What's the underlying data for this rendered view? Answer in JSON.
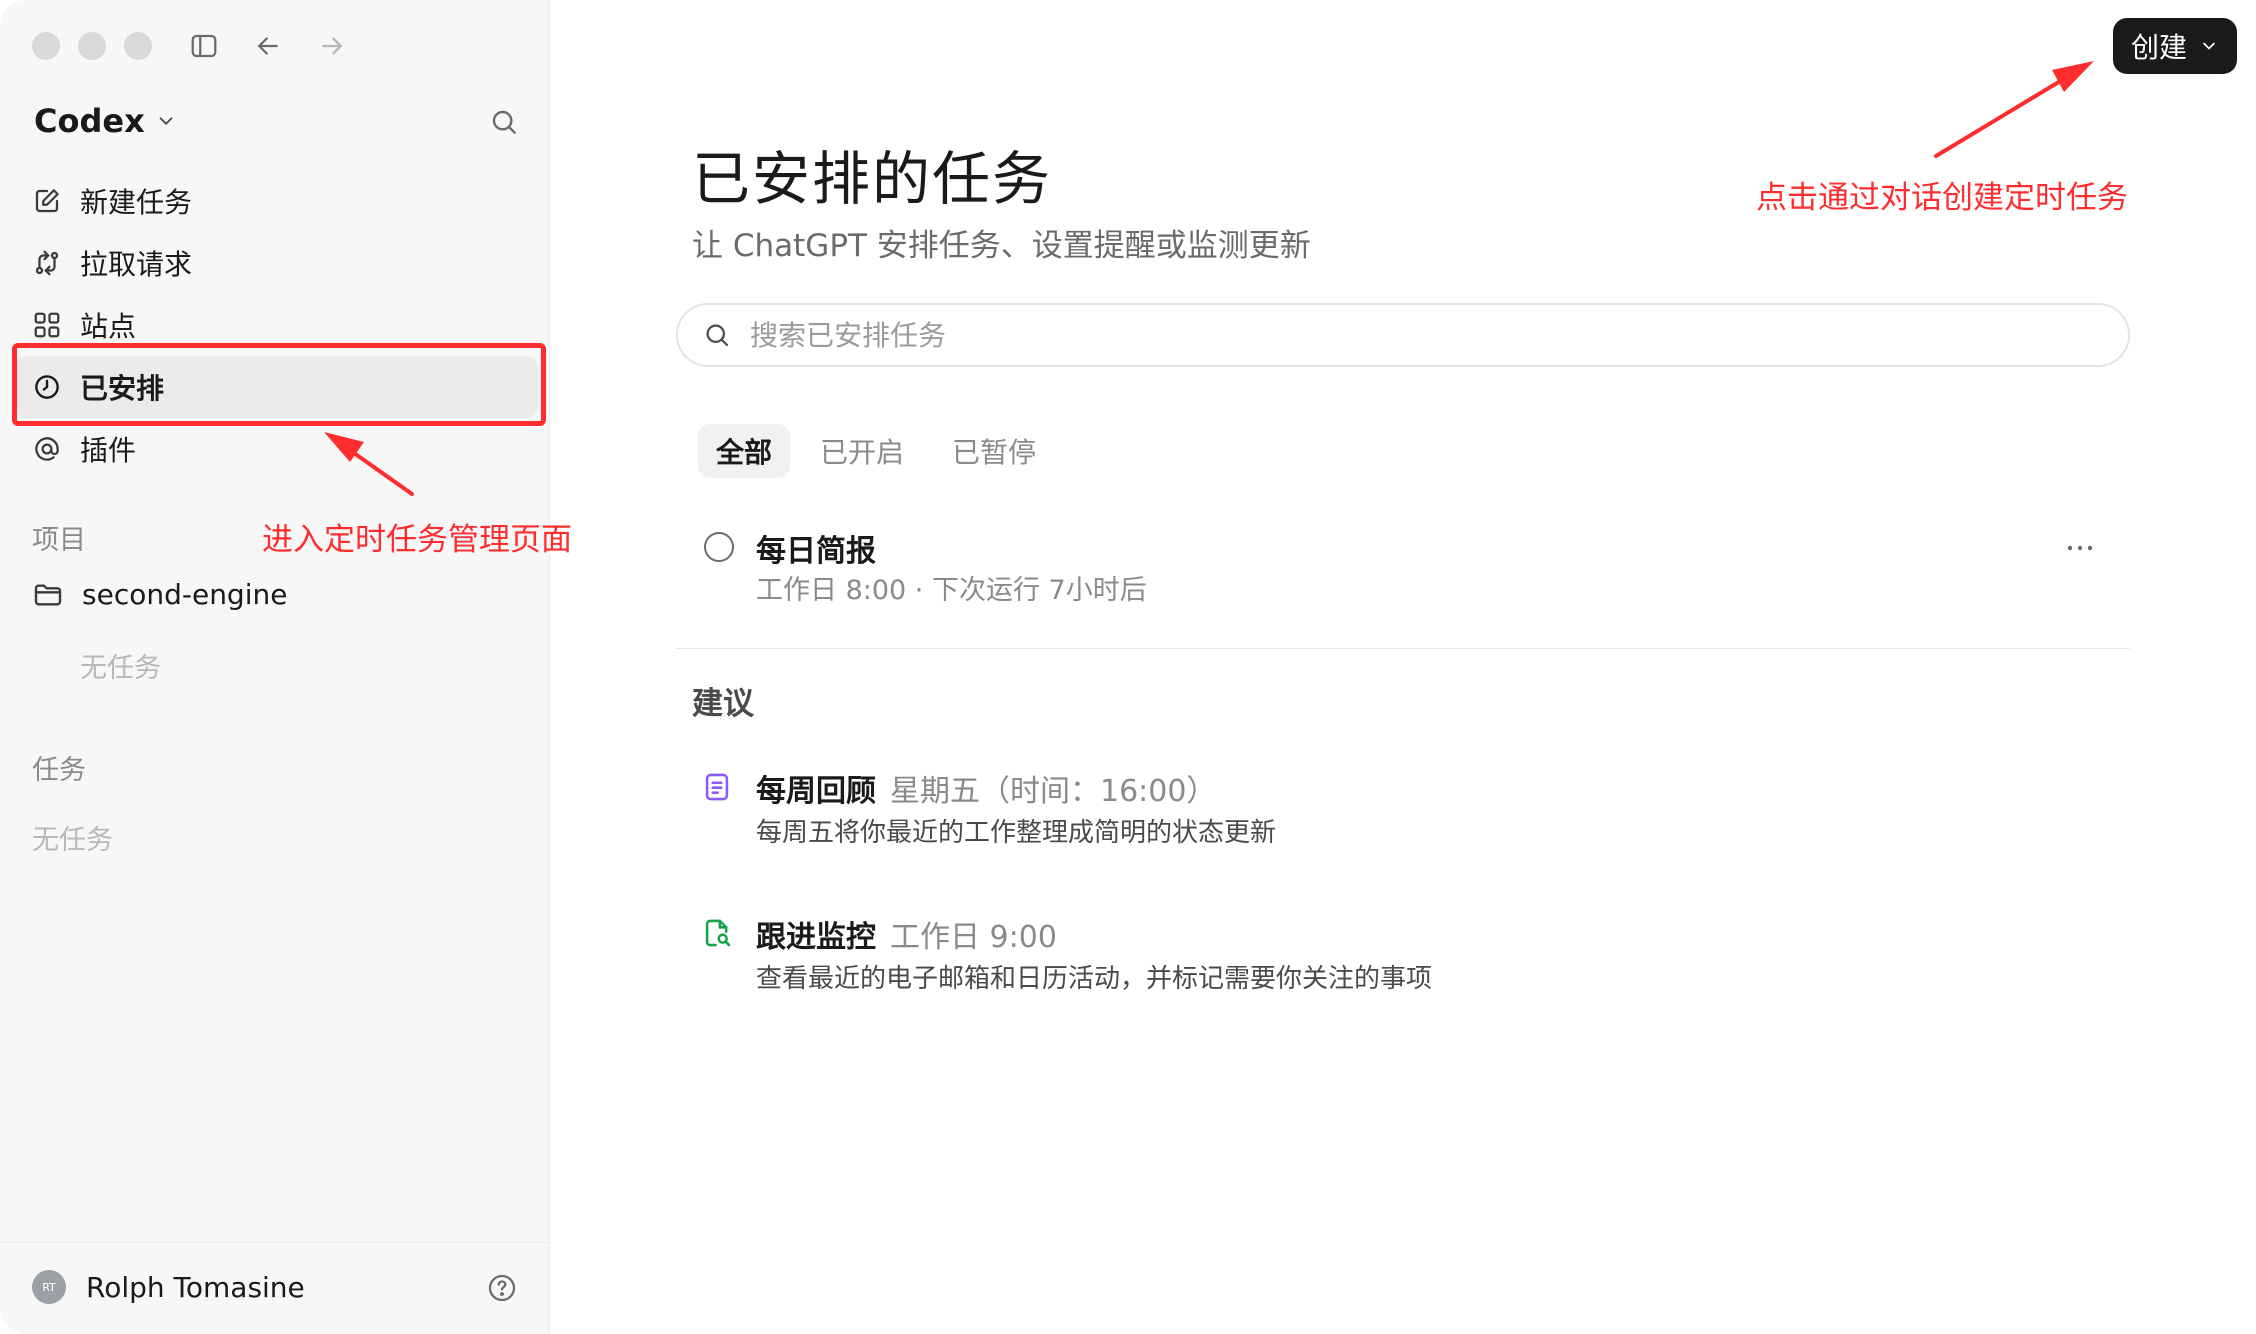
{
  "sidebar": {
    "brand": "Codex",
    "nav": [
      {
        "label": "新建任务",
        "icon": "edit-icon"
      },
      {
        "label": "拉取请求",
        "icon": "pull-request-icon"
      },
      {
        "label": "站点",
        "icon": "grid-icon"
      },
      {
        "label": "已安排",
        "icon": "clock-icon"
      },
      {
        "label": "插件",
        "icon": "plugin-icon"
      }
    ],
    "projects_label": "项目",
    "project_name": "second-engine",
    "project_empty": "无任务",
    "tasks_label": "任务",
    "tasks_empty": "无任务",
    "user_initials": "RT",
    "user_name": "Rolph Tomasine"
  },
  "header": {
    "create_label": "创建"
  },
  "main": {
    "title": "已安排的任务",
    "subtitle": "让 ChatGPT 安排任务、设置提醒或监测更新",
    "search_placeholder": "搜索已安排任务",
    "tabs": [
      {
        "label": "全部",
        "active": true
      },
      {
        "label": "已开启",
        "active": false
      },
      {
        "label": "已暂停",
        "active": false
      }
    ],
    "tasks": [
      {
        "name": "每日简报",
        "meta": "工作日 8:00 · 下次运行 7小时后"
      }
    ],
    "suggestions_title": "建议",
    "suggestions": [
      {
        "name": "每周回顾",
        "schedule": "星期五（时间：16:00）",
        "desc": "每周五将你最近的工作整理成简明的状态更新",
        "icon": "document-icon",
        "color": "#8b5cf6"
      },
      {
        "name": "跟进监控",
        "schedule": "工作日 9:00",
        "desc": "查看最近的电子邮箱和日历活动，并标记需要你关注的事项",
        "icon": "file-search-icon",
        "color": "#16a34a"
      }
    ]
  },
  "annotations": {
    "sidebar_note": "进入定时任务管理页面",
    "create_note": "点击通过对话创建定时任务",
    "color": "#ff2d2d"
  }
}
